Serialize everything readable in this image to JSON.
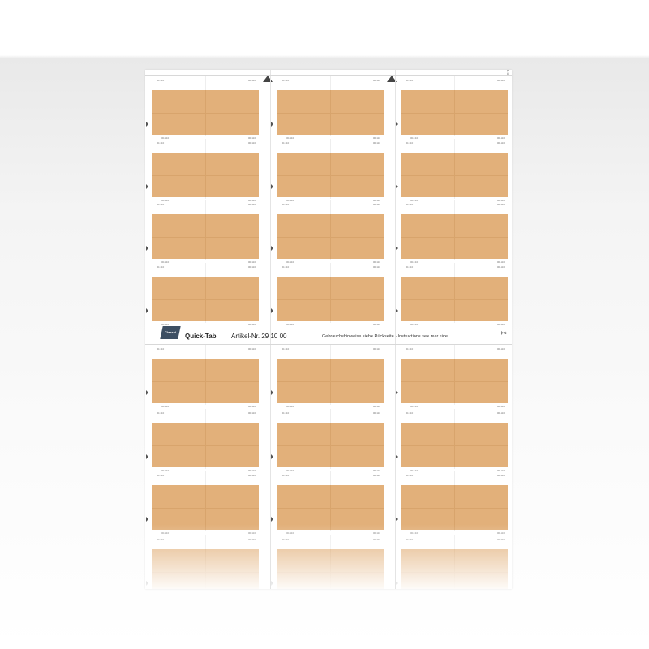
{
  "sheet": {
    "logo_text": "Classei",
    "brand": "Quick-Tab",
    "article": "Artikel-Nr. 29 10 00",
    "instructions": "Gebrauchshinweise siehe Rückseite  -  Instructions see rear side",
    "tab_code": "00-110",
    "side_code": "00-110"
  },
  "colors": {
    "tab_fill": "#e2b07a",
    "sheet": "#ffffff",
    "background": "#f4f4f4"
  },
  "icons": [
    "scissors-icon",
    "triangle-up-icon",
    "notch-arrow-icon"
  ]
}
